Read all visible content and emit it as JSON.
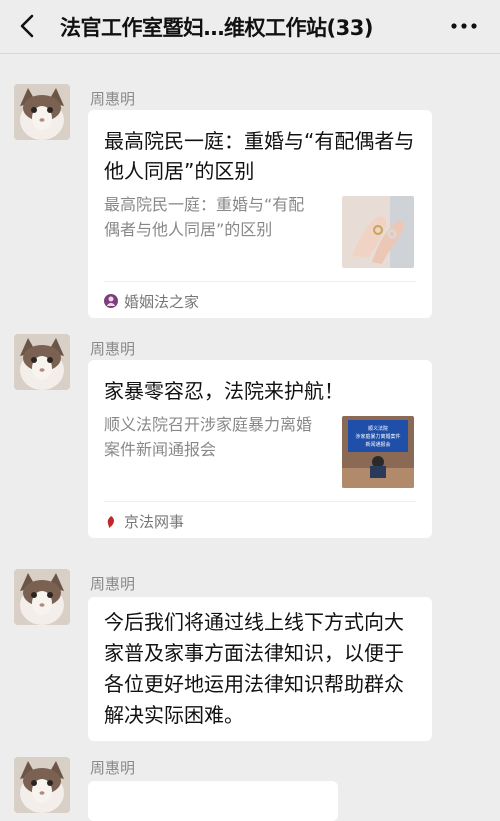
{
  "header": {
    "title": "法官工作室暨妇…维权工作站(33)"
  },
  "messages": [
    {
      "sender": "周惠明",
      "type": "card",
      "title": "最高院民一庭：重婚与“有配偶者与他人同居”的区别",
      "desc": "最高院民一庭：重婚与“有配偶者与他人同居”的区别",
      "source": "婚姻法之家"
    },
    {
      "sender": "周惠明",
      "type": "card",
      "title": "家暴零容忍，法院来护航！",
      "desc": "顺义法院召开涉家庭暴力离婚案件新闻通报会",
      "source": "京法网事",
      "thumb_banner": "顺义法院 涉家庭暴力离婚案件 新闻通报会"
    },
    {
      "sender": "周惠明",
      "type": "text",
      "text": "今后我们将通过线上线下方式向大家普及家事方面法律知识，以便于各位更好地运用法律知识帮助群众解决实际困难。"
    },
    {
      "sender": "周惠明",
      "type": "text",
      "text": ""
    }
  ],
  "icons": {
    "back": "chevron-left-icon",
    "more": "more-dots-icon",
    "source1": "hunyin-logo-icon",
    "source2": "jingfa-logo-icon"
  },
  "colors": {
    "background": "#ededed",
    "card": "#ffffff",
    "secondary_text": "#888888"
  }
}
